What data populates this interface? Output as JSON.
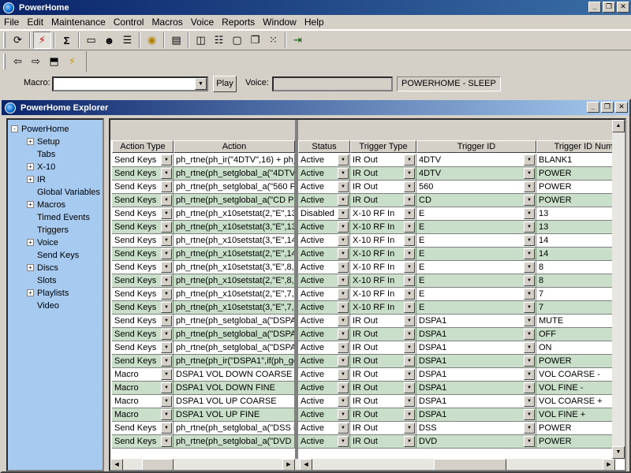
{
  "app": {
    "title": "PowerHome"
  },
  "window_buttons": {
    "minimize": "_",
    "restore": "❐",
    "close": "✕"
  },
  "menu": [
    "File",
    "Edit",
    "Maintenance",
    "Control",
    "Macros",
    "Voice",
    "Reports",
    "Window",
    "Help"
  ],
  "toolbar": {
    "row1": [
      "refresh-icon",
      "lightning-icon",
      "execute-icon",
      "folder-icon",
      "people-icon",
      "list-icon",
      "bulb-icon",
      "document-icon",
      "tile-vertical-icon",
      "tile-horizontal-icon",
      "maximize-icon",
      "cascade-icon",
      "arrange-icon",
      "exit-icon"
    ],
    "row2": [
      "back-icon",
      "forward-icon",
      "up-folder-icon",
      "lightning-small-icon"
    ]
  },
  "macrobar": {
    "macro_label": "Macro:",
    "macro_value": "",
    "play_label": "Play",
    "voice_label": "Voice:",
    "voice_value": "",
    "status_text": "POWERHOME - SLEEP"
  },
  "explorer": {
    "title": "PowerHome Explorer",
    "tree": [
      {
        "label": "PowerHome",
        "level": 0,
        "expander": "-"
      },
      {
        "label": "Setup",
        "level": 1,
        "expander": "+"
      },
      {
        "label": "Tabs",
        "level": 1,
        "expander": ""
      },
      {
        "label": "X-10",
        "level": 1,
        "expander": "+"
      },
      {
        "label": "IR",
        "level": 1,
        "expander": "+"
      },
      {
        "label": "Global Variables",
        "level": 1,
        "expander": ""
      },
      {
        "label": "Macros",
        "level": 1,
        "expander": "+"
      },
      {
        "label": "Timed Events",
        "level": 1,
        "expander": ""
      },
      {
        "label": "Triggers",
        "level": 1,
        "expander": ""
      },
      {
        "label": "Voice",
        "level": 1,
        "expander": "+"
      },
      {
        "label": "Send Keys",
        "level": 1,
        "expander": ""
      },
      {
        "label": "Discs",
        "level": 1,
        "expander": "+"
      },
      {
        "label": "Slots",
        "level": 1,
        "expander": ""
      },
      {
        "label": "Playlists",
        "level": 1,
        "expander": "+"
      },
      {
        "label": "Video",
        "level": 1,
        "expander": ""
      }
    ],
    "selected": "Triggers"
  },
  "grid": {
    "headers": [
      "Action Type",
      "Action",
      "Status",
      "Trigger Type",
      "Trigger ID",
      "Trigger ID Num"
    ],
    "rows": [
      [
        "Send Keys",
        "ph_rtne(ph_ir(\"4DTV\",16) + ph_",
        "Active",
        "IR Out",
        "4DTV",
        "BLANK1"
      ],
      [
        "Send Keys",
        "ph_rtne(ph_setglobal_a(\"4DTV",
        "Active",
        "IR Out",
        "4DTV",
        "POWER"
      ],
      [
        "Send Keys",
        "ph_rtne(ph_setglobal_a(\"560 P",
        "Active",
        "IR Out",
        "560",
        "POWER"
      ],
      [
        "Send Keys",
        "ph_rtne(ph_setglobal_a(\"CD PC",
        "Active",
        "IR Out",
        "CD",
        "POWER"
      ],
      [
        "Send Keys",
        "ph_rtne(ph_x10setstat(2,\"E\",13",
        "Disabled",
        "X-10 RF In",
        "E",
        "13"
      ],
      [
        "Send Keys",
        "ph_rtne(ph_x10setstat(3,\"E\",13",
        "Active",
        "X-10 RF In",
        "E",
        "13"
      ],
      [
        "Send Keys",
        "ph_rtne(ph_x10setstat(3,\"E\",14",
        "Active",
        "X-10 RF In",
        "E",
        "14"
      ],
      [
        "Send Keys",
        "ph_rtne(ph_x10setstat(2,\"E\",14",
        "Active",
        "X-10 RF In",
        "E",
        "14"
      ],
      [
        "Send Keys",
        "ph_rtne(ph_x10setstat(3,\"E\",8,(",
        "Active",
        "X-10 RF In",
        "E",
        "8"
      ],
      [
        "Send Keys",
        "ph_rtne(ph_x10setstat(2,\"E\",8,(",
        "Active",
        "X-10 RF In",
        "E",
        "8"
      ],
      [
        "Send Keys",
        "ph_rtne(ph_x10setstat(2,\"E\",7,(",
        "Active",
        "X-10 RF In",
        "E",
        "7"
      ],
      [
        "Send Keys",
        "ph_rtne(ph_x10setstat(3,\"E\",7,(",
        "Active",
        "X-10 RF In",
        "E",
        "7"
      ],
      [
        "Send Keys",
        "ph_rtne(ph_setglobal_a(\"DSPA",
        "Active",
        "IR Out",
        "DSPA1",
        "MUTE"
      ],
      [
        "Send Keys",
        "ph_rtne(ph_setglobal_a(\"DSPA",
        "Active",
        "IR Out",
        "DSPA1",
        "OFF"
      ],
      [
        "Send Keys",
        "ph_rtne(ph_setglobal_a(\"DSPA",
        "Active",
        "IR Out",
        "DSPA1",
        "ON"
      ],
      [
        "Send Keys",
        "ph_rtne(ph_ir(\"DSPA1\",if(ph_ge",
        "Active",
        "IR Out",
        "DSPA1",
        "POWER"
      ],
      [
        "Macro",
        "DSPA1 VOL DOWN COARSE",
        "Active",
        "IR Out",
        "DSPA1",
        "VOL COARSE -"
      ],
      [
        "Macro",
        "DSPA1 VOL DOWN FINE",
        "Active",
        "IR Out",
        "DSPA1",
        "VOL FINE -"
      ],
      [
        "Macro",
        "DSPA1 VOL UP COARSE",
        "Active",
        "IR Out",
        "DSPA1",
        "VOL COARSE +"
      ],
      [
        "Macro",
        "DSPA1 VOL UP FINE",
        "Active",
        "IR Out",
        "DSPA1",
        "VOL FINE +"
      ],
      [
        "Send Keys",
        "ph_rtne(ph_setglobal_a(\"DSS P",
        "Active",
        "IR Out",
        "DSS",
        "POWER"
      ],
      [
        "Send Keys",
        "ph_rtne(ph_setglobal_a(\"DVD P",
        "Active",
        "IR Out",
        "DVD",
        "POWER"
      ]
    ]
  },
  "colors": {
    "title_start": "#0a246a",
    "title_end": "#3a6ea5",
    "tree_bg": "#a6caf0",
    "row_alt": "#c9dfc9"
  }
}
